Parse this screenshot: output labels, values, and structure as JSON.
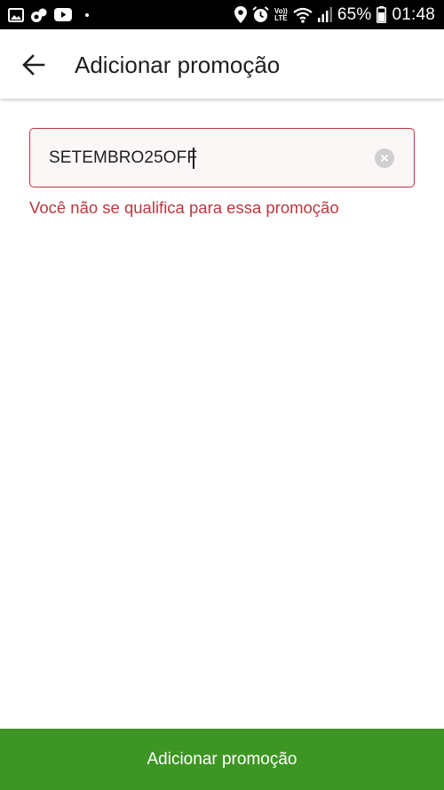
{
  "status_bar": {
    "icons_left": [
      "gallery-icon",
      "notification-app-icon",
      "youtube-icon"
    ],
    "icons_right": [
      "location-icon",
      "alarm-icon",
      "volte-icon",
      "wifi-icon",
      "signal-icon",
      "battery-icon"
    ],
    "volte_line1": "Vo))",
    "volte_line2": "LTE",
    "battery": "65%",
    "time": "01:48"
  },
  "app_bar": {
    "back_icon": "arrow-left-icon",
    "title": "Adicionar promoção"
  },
  "promo": {
    "value": "SETEMBRO25OFF",
    "clear_icon": "clear-icon",
    "error": "Você não se qualifica para essa promoção"
  },
  "footer": {
    "submit_label": "Adicionar promoção"
  },
  "colors": {
    "error": "#b8383f",
    "primary": "#3d9623",
    "status_bar": "#000000"
  }
}
